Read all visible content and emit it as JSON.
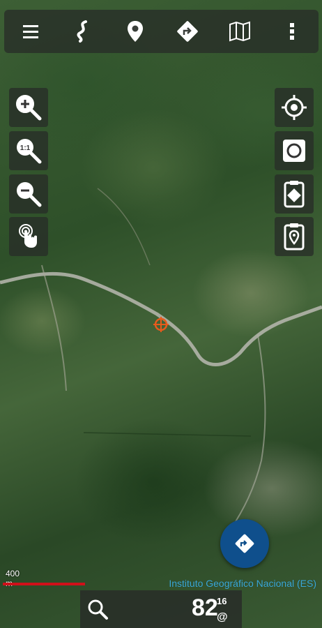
{
  "toolbar": {
    "items": [
      {
        "name": "menu-icon"
      },
      {
        "name": "track-icon"
      },
      {
        "name": "waypoint-icon"
      },
      {
        "name": "route-icon"
      },
      {
        "name": "maps-icon"
      },
      {
        "name": "more-vertical-icon"
      }
    ]
  },
  "left_controls": [
    "zoom-in-icon",
    "zoom-1to1-icon",
    "zoom-out-icon",
    "touch-gesture-icon"
  ],
  "right_controls": [
    "locate-crosshair-icon",
    "record-icon",
    "clipboard-route-icon",
    "clipboard-waypoint-icon"
  ],
  "scale": {
    "label": "400 m",
    "color": "#d0101a"
  },
  "attribution": "Instituto Geográfico Nacional (ES)",
  "fab": {
    "icon": "navigate-icon",
    "color": "#0f4f8c"
  },
  "bottom": {
    "search_icon": "search-icon",
    "zoom_level": "82",
    "zoom_sup": "16",
    "zoom_at": "@"
  },
  "colors": {
    "accent": "#0f4f8c",
    "target": "#e85a1c",
    "attribution": "#3aa8d8"
  }
}
